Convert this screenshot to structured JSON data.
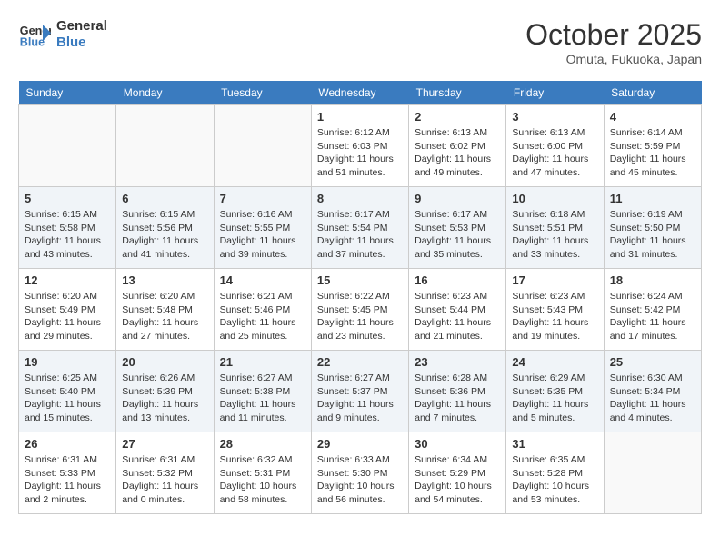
{
  "logo": {
    "line1": "General",
    "line2": "Blue"
  },
  "title": "October 2025",
  "subtitle": "Omuta, Fukuoka, Japan",
  "weekdays": [
    "Sunday",
    "Monday",
    "Tuesday",
    "Wednesday",
    "Thursday",
    "Friday",
    "Saturday"
  ],
  "weeks": [
    [
      {
        "day": "",
        "content": ""
      },
      {
        "day": "",
        "content": ""
      },
      {
        "day": "",
        "content": ""
      },
      {
        "day": "1",
        "content": "Sunrise: 6:12 AM\nSunset: 6:03 PM\nDaylight: 11 hours\nand 51 minutes."
      },
      {
        "day": "2",
        "content": "Sunrise: 6:13 AM\nSunset: 6:02 PM\nDaylight: 11 hours\nand 49 minutes."
      },
      {
        "day": "3",
        "content": "Sunrise: 6:13 AM\nSunset: 6:00 PM\nDaylight: 11 hours\nand 47 minutes."
      },
      {
        "day": "4",
        "content": "Sunrise: 6:14 AM\nSunset: 5:59 PM\nDaylight: 11 hours\nand 45 minutes."
      }
    ],
    [
      {
        "day": "5",
        "content": "Sunrise: 6:15 AM\nSunset: 5:58 PM\nDaylight: 11 hours\nand 43 minutes."
      },
      {
        "day": "6",
        "content": "Sunrise: 6:15 AM\nSunset: 5:56 PM\nDaylight: 11 hours\nand 41 minutes."
      },
      {
        "day": "7",
        "content": "Sunrise: 6:16 AM\nSunset: 5:55 PM\nDaylight: 11 hours\nand 39 minutes."
      },
      {
        "day": "8",
        "content": "Sunrise: 6:17 AM\nSunset: 5:54 PM\nDaylight: 11 hours\nand 37 minutes."
      },
      {
        "day": "9",
        "content": "Sunrise: 6:17 AM\nSunset: 5:53 PM\nDaylight: 11 hours\nand 35 minutes."
      },
      {
        "day": "10",
        "content": "Sunrise: 6:18 AM\nSunset: 5:51 PM\nDaylight: 11 hours\nand 33 minutes."
      },
      {
        "day": "11",
        "content": "Sunrise: 6:19 AM\nSunset: 5:50 PM\nDaylight: 11 hours\nand 31 minutes."
      }
    ],
    [
      {
        "day": "12",
        "content": "Sunrise: 6:20 AM\nSunset: 5:49 PM\nDaylight: 11 hours\nand 29 minutes."
      },
      {
        "day": "13",
        "content": "Sunrise: 6:20 AM\nSunset: 5:48 PM\nDaylight: 11 hours\nand 27 minutes."
      },
      {
        "day": "14",
        "content": "Sunrise: 6:21 AM\nSunset: 5:46 PM\nDaylight: 11 hours\nand 25 minutes."
      },
      {
        "day": "15",
        "content": "Sunrise: 6:22 AM\nSunset: 5:45 PM\nDaylight: 11 hours\nand 23 minutes."
      },
      {
        "day": "16",
        "content": "Sunrise: 6:23 AM\nSunset: 5:44 PM\nDaylight: 11 hours\nand 21 minutes."
      },
      {
        "day": "17",
        "content": "Sunrise: 6:23 AM\nSunset: 5:43 PM\nDaylight: 11 hours\nand 19 minutes."
      },
      {
        "day": "18",
        "content": "Sunrise: 6:24 AM\nSunset: 5:42 PM\nDaylight: 11 hours\nand 17 minutes."
      }
    ],
    [
      {
        "day": "19",
        "content": "Sunrise: 6:25 AM\nSunset: 5:40 PM\nDaylight: 11 hours\nand 15 minutes."
      },
      {
        "day": "20",
        "content": "Sunrise: 6:26 AM\nSunset: 5:39 PM\nDaylight: 11 hours\nand 13 minutes."
      },
      {
        "day": "21",
        "content": "Sunrise: 6:27 AM\nSunset: 5:38 PM\nDaylight: 11 hours\nand 11 minutes."
      },
      {
        "day": "22",
        "content": "Sunrise: 6:27 AM\nSunset: 5:37 PM\nDaylight: 11 hours\nand 9 minutes."
      },
      {
        "day": "23",
        "content": "Sunrise: 6:28 AM\nSunset: 5:36 PM\nDaylight: 11 hours\nand 7 minutes."
      },
      {
        "day": "24",
        "content": "Sunrise: 6:29 AM\nSunset: 5:35 PM\nDaylight: 11 hours\nand 5 minutes."
      },
      {
        "day": "25",
        "content": "Sunrise: 6:30 AM\nSunset: 5:34 PM\nDaylight: 11 hours\nand 4 minutes."
      }
    ],
    [
      {
        "day": "26",
        "content": "Sunrise: 6:31 AM\nSunset: 5:33 PM\nDaylight: 11 hours\nand 2 minutes."
      },
      {
        "day": "27",
        "content": "Sunrise: 6:31 AM\nSunset: 5:32 PM\nDaylight: 11 hours\nand 0 minutes."
      },
      {
        "day": "28",
        "content": "Sunrise: 6:32 AM\nSunset: 5:31 PM\nDaylight: 10 hours\nand 58 minutes."
      },
      {
        "day": "29",
        "content": "Sunrise: 6:33 AM\nSunset: 5:30 PM\nDaylight: 10 hours\nand 56 minutes."
      },
      {
        "day": "30",
        "content": "Sunrise: 6:34 AM\nSunset: 5:29 PM\nDaylight: 10 hours\nand 54 minutes."
      },
      {
        "day": "31",
        "content": "Sunrise: 6:35 AM\nSunset: 5:28 PM\nDaylight: 10 hours\nand 53 minutes."
      },
      {
        "day": "",
        "content": ""
      }
    ]
  ]
}
